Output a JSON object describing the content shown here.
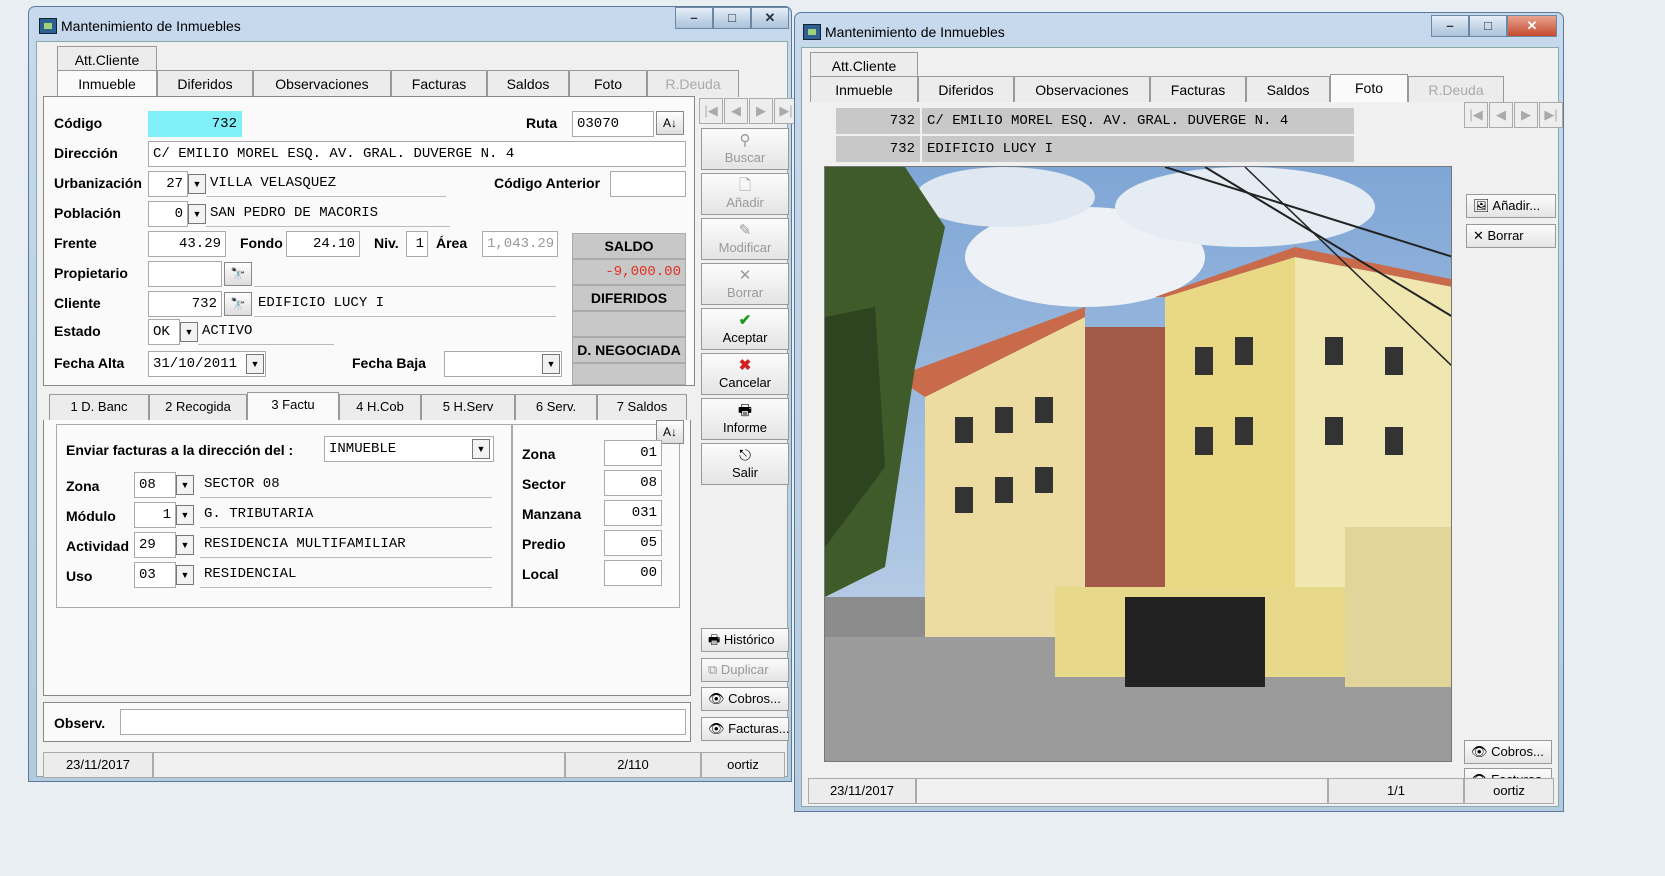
{
  "left": {
    "title": "Mantenimiento de Inmuebles",
    "top_tab": "Att.Cliente",
    "tabs": [
      "Inmueble",
      "Diferidos",
      "Observaciones",
      "Facturas",
      "Saldos",
      "Foto",
      "R.Deuda"
    ],
    "labels": {
      "codigo": "Código",
      "ruta": "Ruta",
      "direccion": "Dirección",
      "urbanizacion": "Urbanización",
      "codigo_anterior": "Código Anterior",
      "poblacion": "Población",
      "frente": "Frente",
      "fondo": "Fondo",
      "niv": "Niv.",
      "area": "Área",
      "propietario": "Propietario",
      "cliente": "Cliente",
      "estado": "Estado",
      "fecha_alta": "Fecha Alta",
      "fecha_baja": "Fecha Baja",
      "observ": "Observ."
    },
    "values": {
      "codigo": "732",
      "ruta": "03070",
      "direccion": "C/ EMILIO MOREL ESQ. AV. GRAL. DUVERGE N. 4",
      "urb_code": "27",
      "urb_name": "VILLA VELASQUEZ",
      "codigo_anterior": "",
      "pob_code": "0",
      "pob_name": "SAN PEDRO DE MACORIS",
      "frente": "43.29",
      "fondo": "24.10",
      "niv": "1",
      "area": "1,043.29",
      "propietario_code": "",
      "propietario_name": "",
      "cliente_code": "732",
      "cliente_name": "EDIFICIO LUCY I",
      "estado_code": "OK",
      "estado_name": "ACTIVO",
      "fecha_alta": "31/10/2011",
      "fecha_baja": "",
      "observ": ""
    },
    "saldo": {
      "saldo_label": "SALDO",
      "saldo_value": "-9,000.00",
      "diferidos_label": "DIFERIDOS",
      "dneg_label": "D. NEGOCIADA"
    },
    "side_buttons": [
      "Buscar",
      "Añadir",
      "Modificar",
      "Borrar",
      "Aceptar",
      "Cancelar",
      "Informe",
      "Salir"
    ],
    "lower_buttons": [
      "Histórico",
      "Duplicar",
      "Cobros...",
      "Facturas..."
    ],
    "sub_tabs": [
      "1 D. Banc",
      "2 Recogida",
      "3 Factu",
      "4 H.Cob",
      "5 H.Serv",
      "6 Serv.",
      "7 Saldos"
    ],
    "factu": {
      "enviar_label": "Enviar facturas a la dirección del :",
      "enviar_value": "INMUEBLE",
      "rows": [
        {
          "label": "Zona",
          "code": "08",
          "desc": "SECTOR 08"
        },
        {
          "label": "Módulo",
          "code": "1",
          "desc": "G. TRIBUTARIA"
        },
        {
          "label": "Actividad",
          "code": "29",
          "desc": "RESIDENCIA MULTIFAMILIAR"
        },
        {
          "label": "Uso",
          "code": "03",
          "desc": "RESIDENCIAL"
        }
      ],
      "right_rows": [
        {
          "label": "Zona",
          "value": "01"
        },
        {
          "label": "Sector",
          "value": "08"
        },
        {
          "label": "Manzana",
          "value": "031"
        },
        {
          "label": "Predio",
          "value": "05"
        },
        {
          "label": "Local",
          "value": "00"
        }
      ]
    },
    "status": {
      "date": "23/11/2017",
      "record": "2/110",
      "user": "oortiz"
    }
  },
  "right": {
    "title": "Mantenimiento de Inmuebles",
    "top_tab": "Att.Cliente",
    "tabs": [
      "Inmueble",
      "Diferidos",
      "Observaciones",
      "Facturas",
      "Saldos",
      "Foto",
      "R.Deuda"
    ],
    "row1": {
      "code": "732",
      "text": "C/ EMILIO MOREL ESQ. AV. GRAL. DUVERGE N. 4"
    },
    "row2": {
      "code": "732",
      "text": "EDIFICIO LUCY I"
    },
    "buttons": [
      "Añadir...",
      "Borrar",
      "Cobros...",
      "Facturas..."
    ],
    "status": {
      "date": "23/11/2017",
      "record": "1/1",
      "user": "oortiz"
    }
  },
  "colors": {
    "codigo_bg": "#7ff0f8",
    "negative": "#e03020",
    "accept": "#1a9a1a",
    "cancel": "#d02020"
  }
}
